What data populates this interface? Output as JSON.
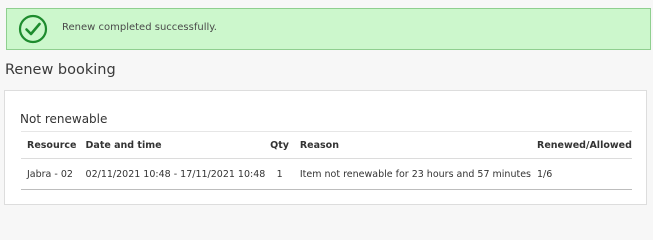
{
  "alert": {
    "message": "Renew completed successfully.",
    "icon": "checkmark-circle-icon",
    "color_bg": "#ccf7cc",
    "color_icon": "#1e8b2e"
  },
  "page": {
    "title": "Renew booking"
  },
  "section": {
    "title": "Not renewable"
  },
  "table": {
    "headers": {
      "resource": "Resource",
      "datetime": "Date and time",
      "qty": "Qty",
      "reason": "Reason",
      "renewed_allowed": "Renewed/Allowed"
    },
    "rows": [
      {
        "resource": "Jabra - 02",
        "datetime": "02/11/2021 10:48 - 17/11/2021 10:48",
        "qty": "1",
        "reason": "Item not renewable for 23 hours and 57 minutes",
        "renewed_allowed": "1/6"
      }
    ]
  }
}
